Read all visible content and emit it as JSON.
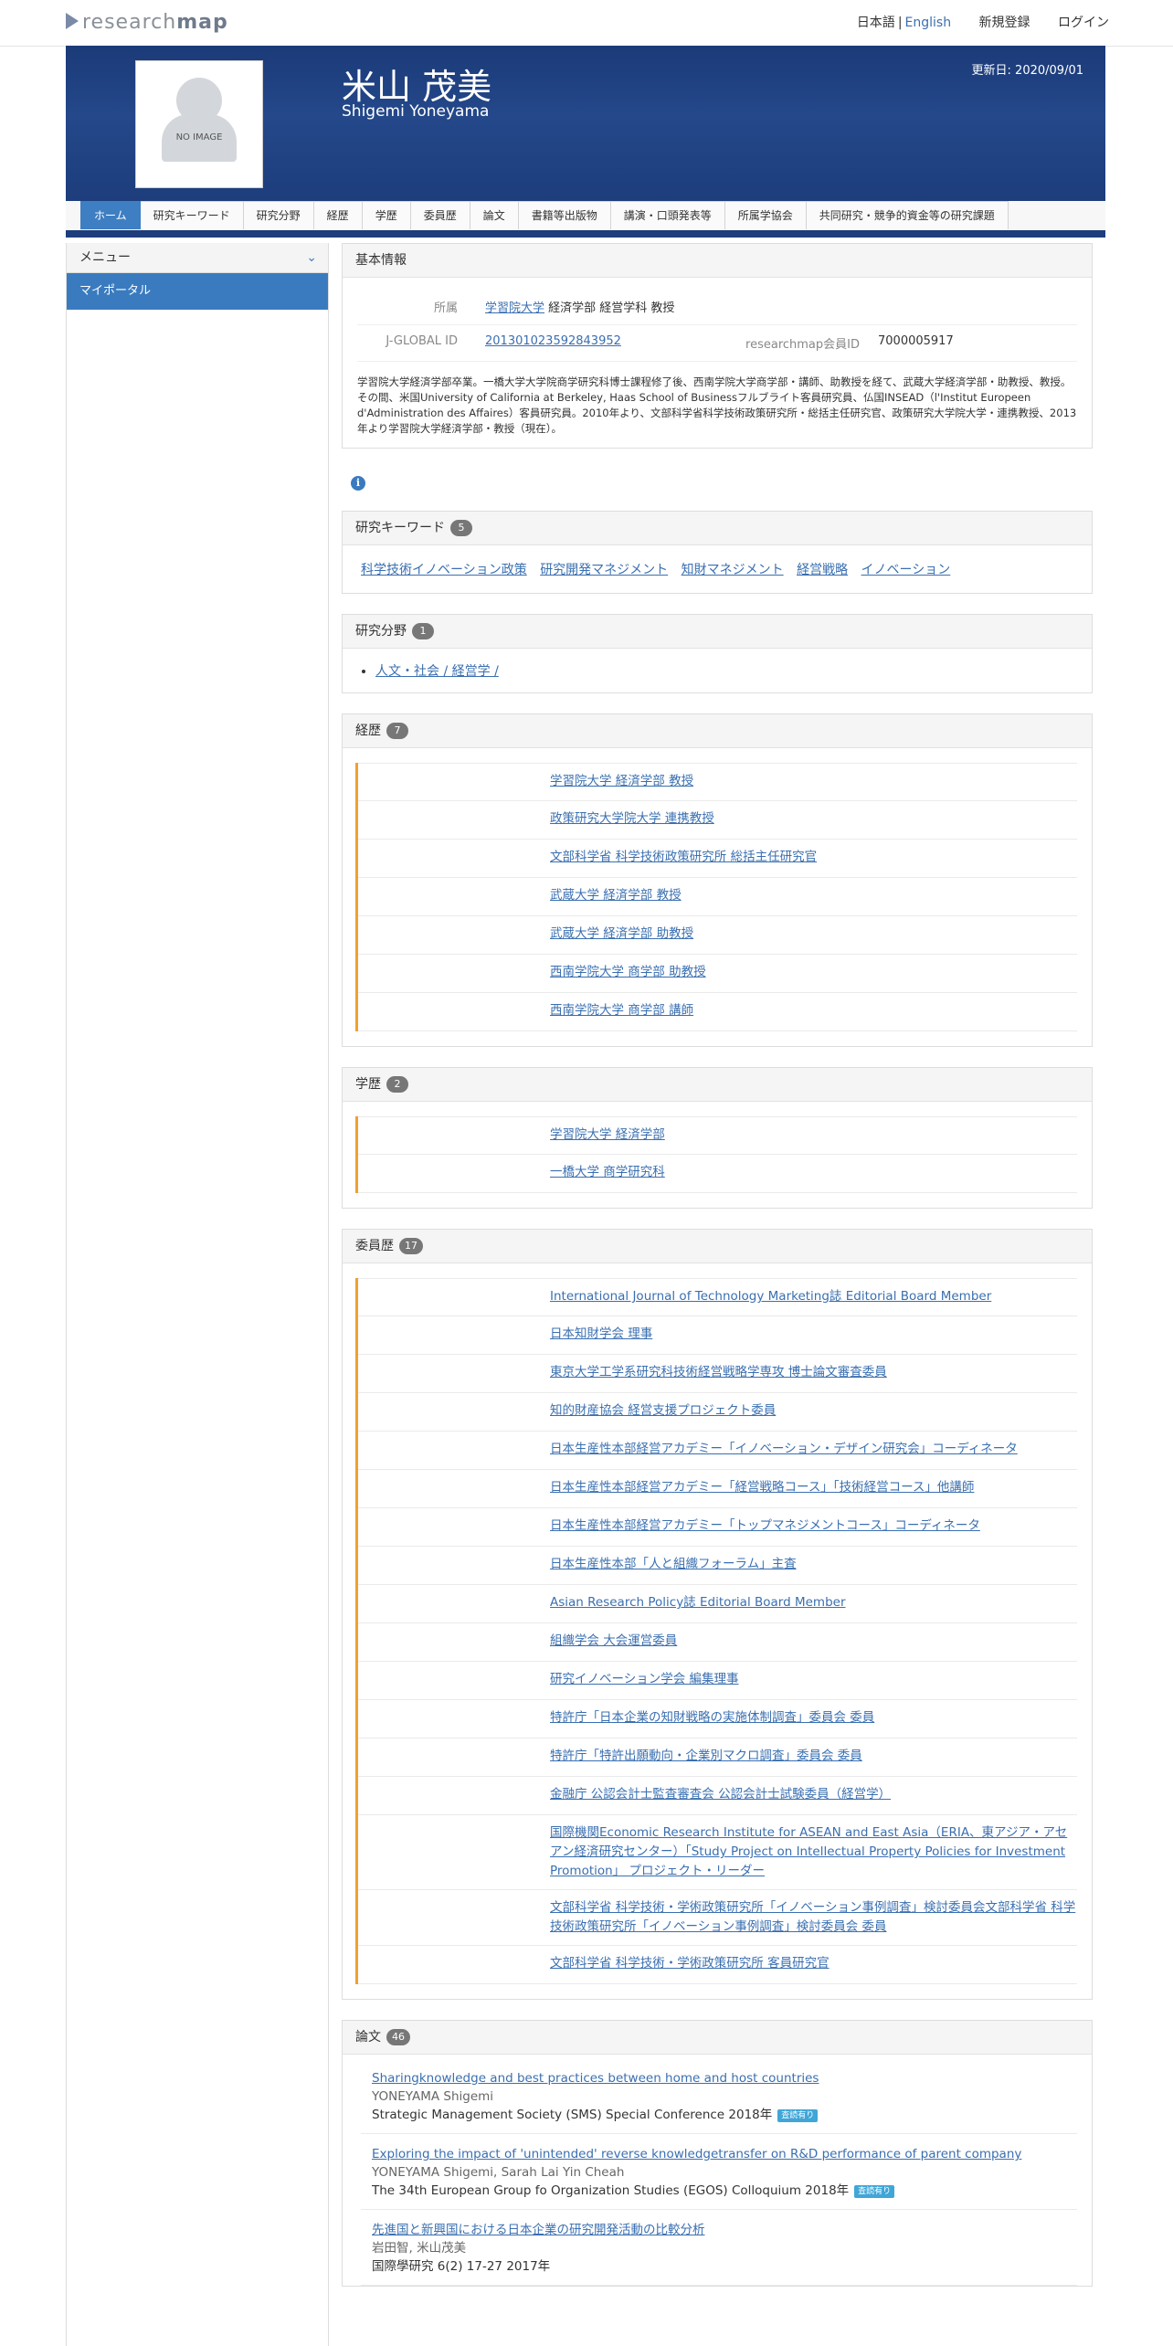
{
  "site": {
    "logo_light": "research",
    "logo_bold": "map"
  },
  "nav": {
    "lang_ja": "日本語",
    "sep": "|",
    "lang_en": "English",
    "signup": "新規登録",
    "login": "ログイン"
  },
  "profile": {
    "name": "米山 茂美",
    "name_en": "Shigemi Yoneyama",
    "updated": "更新日: 2020/09/01",
    "no_image": "NO IMAGE"
  },
  "tabs": [
    "ホーム",
    "研究キーワード",
    "研究分野",
    "経歴",
    "学歴",
    "委員歴",
    "論文",
    "書籍等出版物",
    "講演・口頭発表等",
    "所属学協会",
    "共同研究・競争的資金等の研究課題"
  ],
  "sidebar": {
    "menu_label": "メニュー",
    "item": "マイポータル"
  },
  "basic": {
    "title": "基本情報",
    "affil_label": "所属",
    "affil_link": "学習院大学",
    "affil_rest": " 経済学部 経営学科 教授",
    "jglobal_label": "J-GLOBAL ID",
    "jglobal_value": "201301023592843952",
    "rmap_label": "researchmap会員ID",
    "rmap_value": "7000005917",
    "bio": "学習院大学経済学部卒業。一橋大学大学院商学研究科博士課程修了後、西南学院大学商学部・講師、助教授を経て、武蔵大学経済学部・助教授、教授。その間、米国University of California at Berkeley, Haas School of Businessフルブライト客員研究員、仏国INSEAD（l'Institut Europeen d'Administration des Affaires）客員研究員。2010年より、文部科学省科学技術政策研究所・総括主任研究官、政策研究大学院大学・連携教授、2013年より学習院大学経済学部・教授（現在）。"
  },
  "info_icon": "i",
  "keywords": {
    "title": "研究キーワード",
    "count": "5",
    "items": [
      "科学技術イノベーション政策",
      "研究開発マネジメント",
      "知財マネジメント",
      "経営戦略",
      "イノベーション"
    ]
  },
  "fields": {
    "title": "研究分野",
    "count": "1",
    "items": [
      "人文・社会 / 経営学 /"
    ]
  },
  "career": {
    "title": "経歴",
    "count": "7",
    "items": [
      "学習院大学 経済学部 教授",
      "政策研究大学院大学 連携教授",
      "文部科学省 科学技術政策研究所 総括主任研究官",
      "武蔵大学 経済学部 教授",
      "武蔵大学 経済学部 助教授",
      "西南学院大学 商学部 助教授",
      "西南学院大学 商学部 講師"
    ]
  },
  "education": {
    "title": "学歴",
    "count": "2",
    "items": [
      "学習院大学 経済学部",
      "一橋大学 商学研究科"
    ]
  },
  "committee": {
    "title": "委員歴",
    "count": "17",
    "items": [
      "International Journal of Technology Marketing誌 Editorial Board Member",
      "日本知財学会 理事",
      "東京大学工学系研究科技術経営戦略学専攻 博士論文審査委員",
      "知的財産協会 経営支援プロジェクト委員",
      "日本生産性本部経営アカデミー「イノベーション・デザイン研究会」コーディネータ",
      "日本生産性本部経営アカデミー「経営戦略コース」「技術経営コース」他講師",
      "日本生産性本部経営アカデミー「トップマネジメントコース」コーディネータ",
      "日本生産性本部「人と組織フォーラム」主査",
      "Asian Research Policy誌 Editorial Board Member",
      "組織学会 大会運営委員",
      "研究イノベーション学会 編集理事",
      "特許庁「日本企業の知財戦略の実施体制調査」委員会 委員",
      "特許庁「特許出願動向・企業別マクロ調査」委員会 委員",
      "金融庁 公認会計士監査審査会 公認会計士試験委員（経営学）",
      "国際機関Economic Research Institute for ASEAN and East Asia（ERIA、東アジア・アセアン経済研究センター）「Study Project on Intellectual Property Policies for Investment Promotion」 プロジェクト・リーダー",
      "文部科学省 科学技術・学術政策研究所「イノベーション事例調査」検討委員会文部科学省 科学技術政策研究所「イノベーション事例調査」検討委員会 委員",
      "文部科学省 科学技術・学術政策研究所 客員研究官"
    ]
  },
  "papers": {
    "title": "論文",
    "count": "46",
    "items": [
      {
        "title": "Sharingknowledge and best practices between home and host countries",
        "authors": "YONEYAMA Shigemi",
        "venue": "Strategic Management Society (SMS) Special Conference 2018年",
        "tag": "査読有り"
      },
      {
        "title": "Exploring the impact of 'unintended' reverse knowledgetransfer on R&D performance of parent company",
        "authors": "YONEYAMA Shigemi, Sarah Lai Yin Cheah",
        "venue": "The 34th European Group fo Organization Studies (EGOS) Colloquium 2018年",
        "tag": "査読有り"
      },
      {
        "title": "先進国と新興国における日本企業の研究開発活動の比較分析",
        "authors": "岩田智, 米山茂美",
        "venue": "国際學研究 6(2) 17-27 2017年",
        "tag": ""
      }
    ]
  }
}
